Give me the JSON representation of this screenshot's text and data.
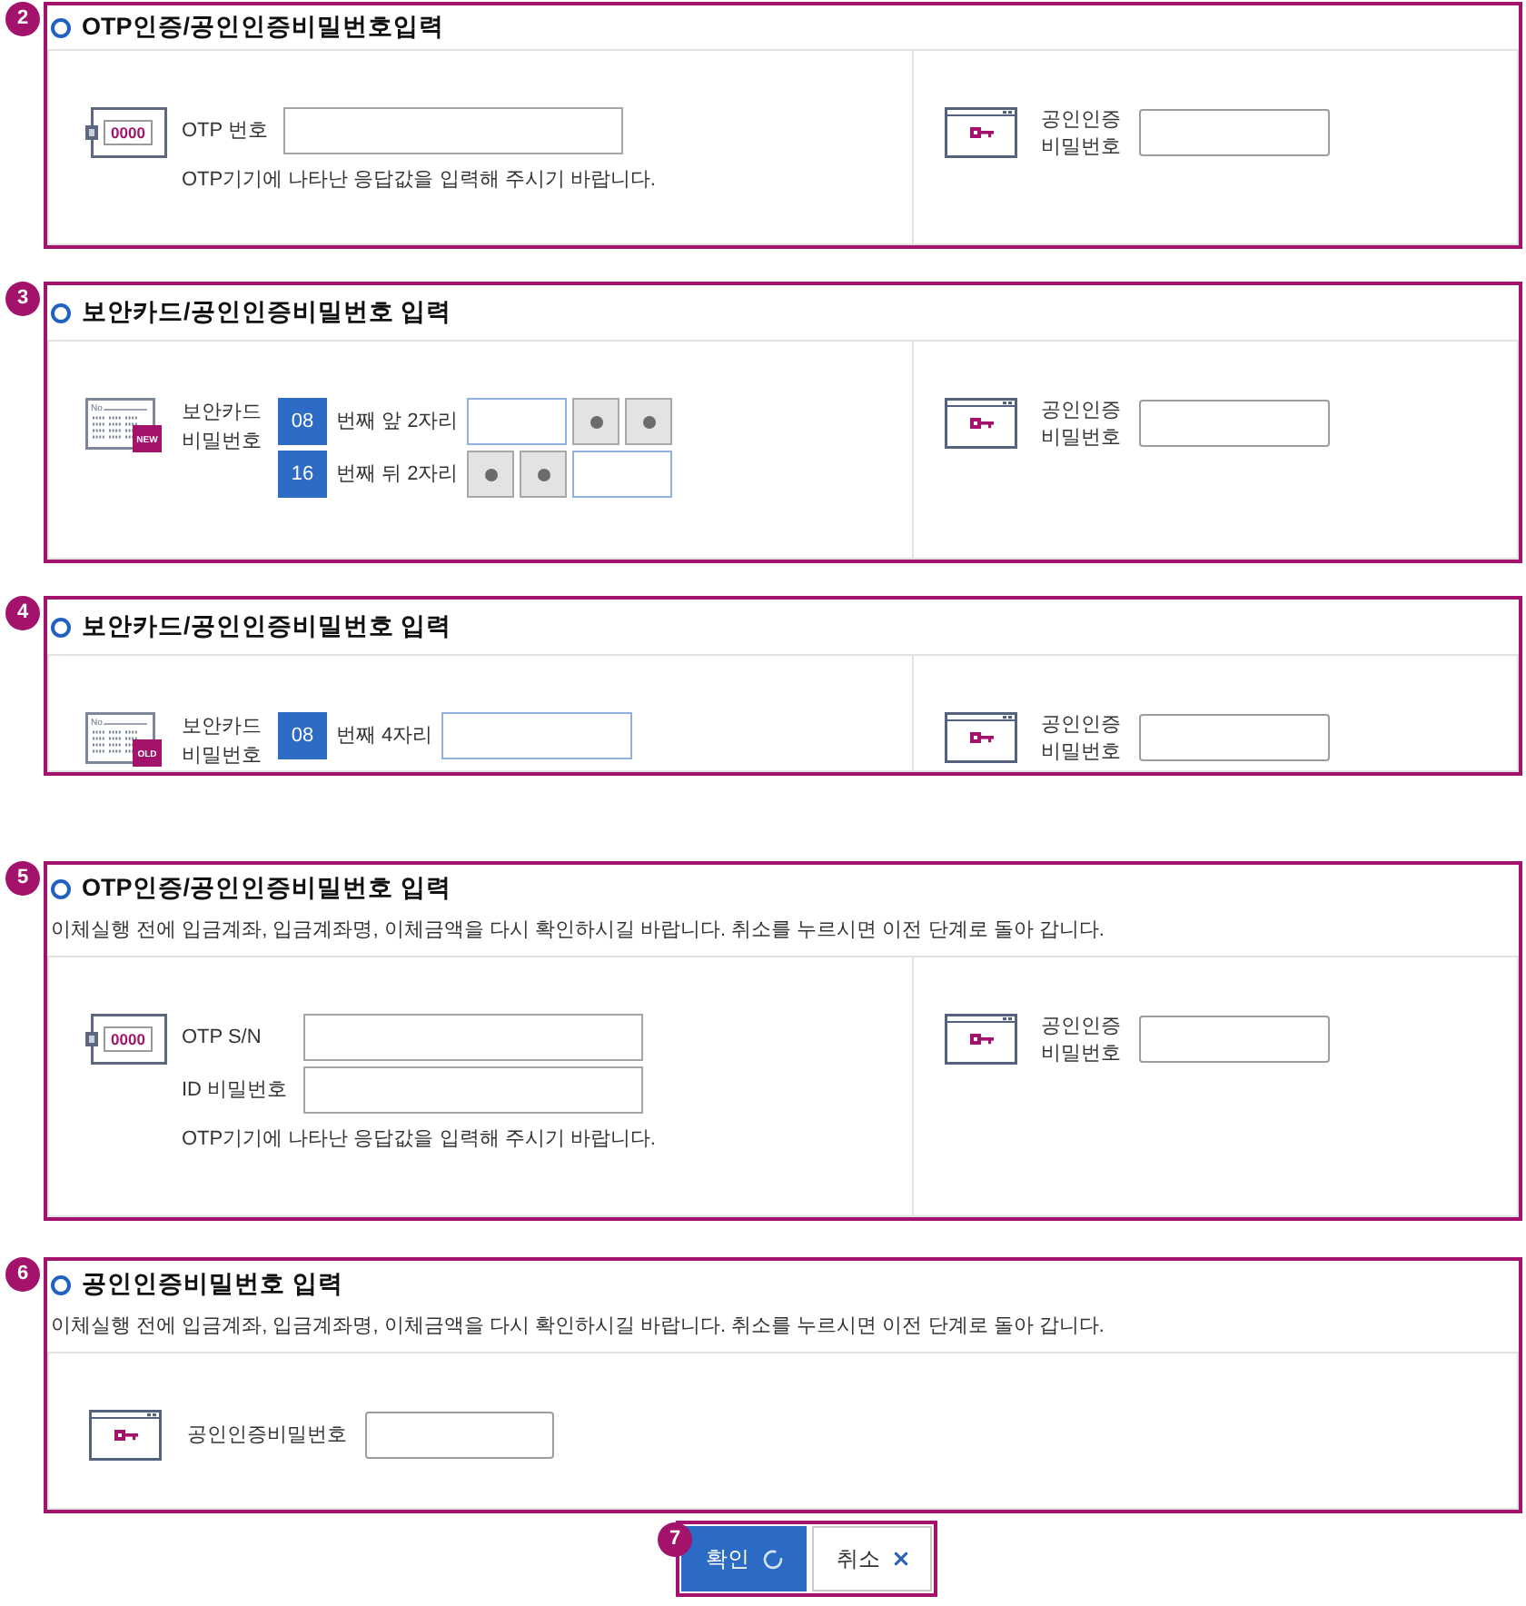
{
  "sections": [
    {
      "badge": "2",
      "title": "OTP인증/공인인증비밀번호입력",
      "kind": "split",
      "left": {
        "device": {
          "kind": "otp",
          "code": "0000"
        },
        "rows": [
          {
            "kind": "field",
            "label": "OTP 번호"
          }
        ],
        "hint": "OTP기기에 나타난 응답값을 입력해 주시기 바랍니다."
      },
      "cert": {
        "label": "공인인증 비밀번호"
      }
    },
    {
      "badge": "3",
      "title": "보안카드/공인인증비밀번호 입력",
      "kind": "split",
      "left": {
        "device": {
          "kind": "card",
          "header": "No.",
          "tag": "NEW"
        },
        "label": "보안카드 비밀번호",
        "rows": [
          {
            "kind": "card",
            "index": "08",
            "text": "번째 앞 2자리",
            "cells": [
              {
                "kind": "input"
              },
              {
                "kind": "masked"
              },
              {
                "kind": "masked"
              }
            ]
          },
          {
            "kind": "card",
            "index": "16",
            "text": "번째 뒤 2자리",
            "cells": [
              {
                "kind": "masked"
              },
              {
                "kind": "masked"
              },
              {
                "kind": "input"
              }
            ]
          }
        ]
      },
      "cert": {
        "label": "공인인증 비밀번호"
      }
    },
    {
      "badge": "4",
      "title": "보안카드/공인인증비밀번호 입력",
      "kind": "split",
      "left": {
        "device": {
          "kind": "card",
          "header": "No.",
          "tag": "OLD"
        },
        "label": "보안카드 비밀번호",
        "rows": [
          {
            "kind": "card",
            "index": "08",
            "text": "번째 4자리",
            "cells": [
              {
                "kind": "wide_input"
              }
            ]
          }
        ]
      },
      "cert": {
        "label": "공인인증 비밀번호"
      }
    },
    {
      "badge": "5",
      "title": "OTP인증/공인인증비밀번호 입력",
      "note": "이체실행 전에 입금계좌, 입금계좌명, 이체금액을 다시 확인하시길 바랍니다. 취소를 누르시면 이전 단계로 돌아 갑니다.",
      "kind": "split",
      "left": {
        "device": {
          "kind": "otp",
          "code": "0000"
        },
        "rows": [
          {
            "kind": "field",
            "label": "OTP S/N"
          },
          {
            "kind": "field",
            "label": "ID 비밀번호"
          }
        ],
        "hint": "OTP기기에 나타난 응답값을 입력해 주시기 바랍니다."
      },
      "cert": {
        "label": "공인인증 비밀번호"
      }
    },
    {
      "badge": "6",
      "title": "공인인증비밀번호 입력",
      "note": "이체실행 전에 입금계좌, 입금계좌명, 이체금액을 다시 확인하시길 바랍니다. 취소를 누르시면 이전 단계로 돌아 갑니다.",
      "kind": "single",
      "cert": {
        "label": "공인인증비밀번호"
      }
    }
  ],
  "actions": {
    "badge": "7",
    "buttons": [
      {
        "kind": "confirm",
        "label": "확인"
      },
      {
        "kind": "cancel",
        "label": "취소"
      }
    ]
  }
}
